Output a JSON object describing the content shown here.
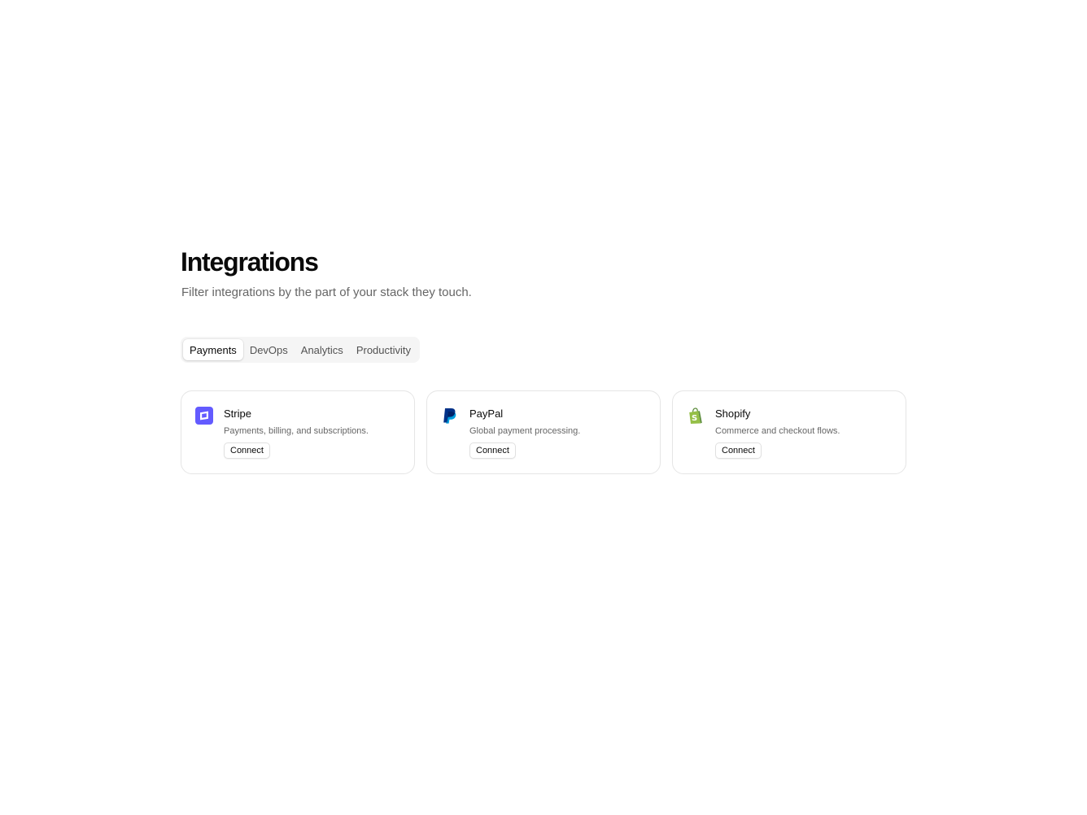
{
  "header": {
    "title": "Integrations",
    "subtitle": "Filter integrations by the part of your stack they touch."
  },
  "tabs": [
    {
      "label": "Payments",
      "active": true
    },
    {
      "label": "DevOps",
      "active": false
    },
    {
      "label": "Analytics",
      "active": false
    },
    {
      "label": "Productivity",
      "active": false
    }
  ],
  "integrations": [
    {
      "name": "Stripe",
      "description": "Payments, billing, and subscriptions.",
      "button_label": "Connect",
      "icon": "stripe-logo-icon",
      "brand_color": "#635bff"
    },
    {
      "name": "PayPal",
      "description": "Global payment processing.",
      "button_label": "Connect",
      "icon": "paypal-logo-icon",
      "brand_color": "#003087"
    },
    {
      "name": "Shopify",
      "description": "Commerce and checkout flows.",
      "button_label": "Connect",
      "icon": "shopify-logo-icon",
      "brand_color": "#95bf47"
    }
  ]
}
